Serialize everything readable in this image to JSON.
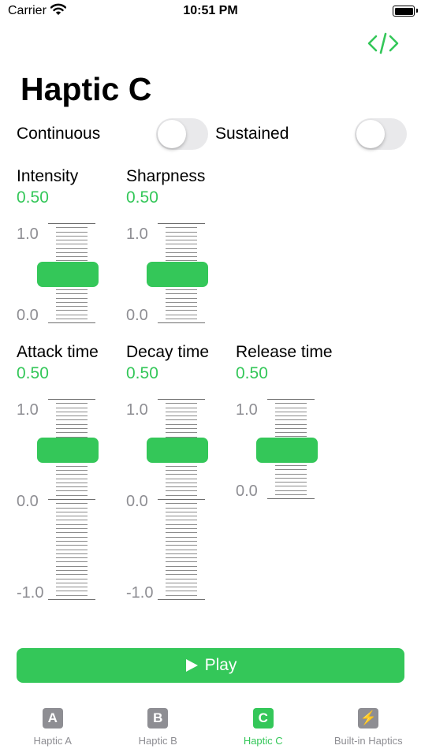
{
  "status_bar": {
    "carrier": "Carrier",
    "time": "10:51 PM"
  },
  "header": {
    "code_icon": "code-brackets-icon",
    "title": "Haptic C"
  },
  "toggles": [
    {
      "label": "Continuous",
      "on": false
    },
    {
      "label": "Sustained",
      "on": false
    }
  ],
  "sliders": [
    {
      "label": "Intensity",
      "value": "0.50",
      "max_label": "1.0",
      "min_label": "0.0"
    },
    {
      "label": "Sharpness",
      "value": "0.50",
      "max_label": "1.0",
      "min_label": "0.0"
    },
    {
      "label": "Attack time",
      "value": "0.50",
      "max_label": "1.0",
      "mid_label": "0.0",
      "min_label": "-1.0"
    },
    {
      "label": "Decay time",
      "value": "0.50",
      "max_label": "1.0",
      "mid_label": "0.0",
      "min_label": "-1.0"
    },
    {
      "label": "Release time",
      "value": "0.50",
      "max_label": "1.0",
      "min_label": "0.0"
    }
  ],
  "play_button": {
    "label": "Play",
    "icon": "play-icon"
  },
  "tabs": [
    {
      "glyph": "A",
      "label": "Haptic A",
      "active": false
    },
    {
      "glyph": "B",
      "label": "Haptic B",
      "active": false
    },
    {
      "glyph": "C",
      "label": "Haptic C",
      "active": true
    },
    {
      "glyph": "⚡",
      "label": "Built-in Haptics",
      "active": false
    }
  ],
  "colors": {
    "accent": "#34c759",
    "secondary_text": "#8e8e93",
    "switch_off": "#e9e9eb"
  }
}
